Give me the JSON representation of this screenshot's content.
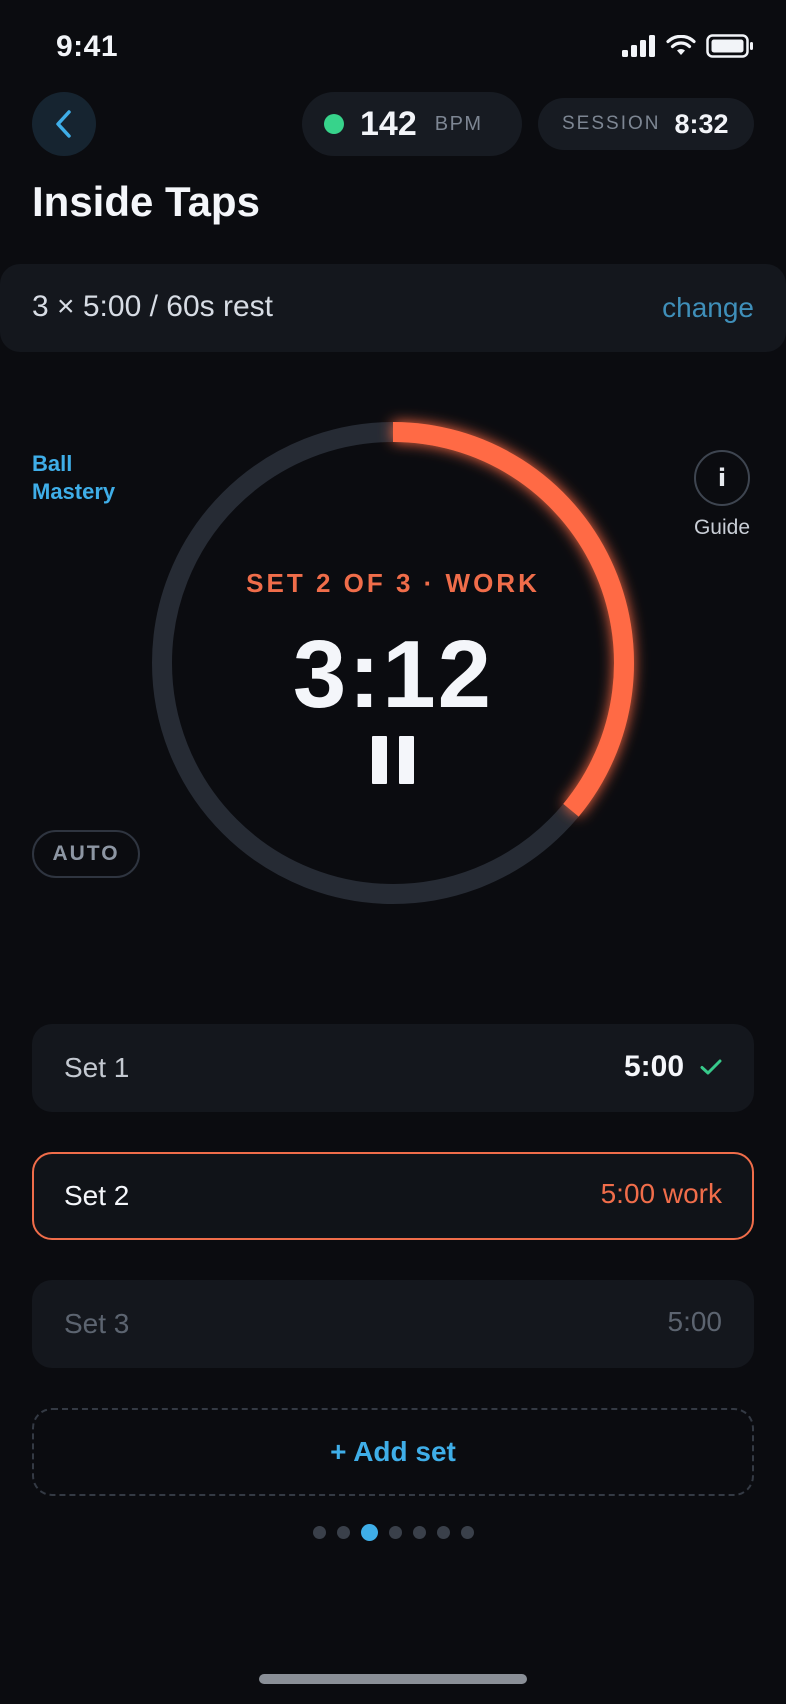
{
  "status_bar": {
    "time": "9:41"
  },
  "header": {
    "bpm_value": "142",
    "bpm_unit": "BPM",
    "session_label": "SESSION",
    "session_time": "8:32",
    "title": "Inside Taps"
  },
  "config": {
    "text": "3 × 5:00 / 60s rest",
    "change_label": "change"
  },
  "timer": {
    "category_line1": "Ball",
    "category_line2": "Mastery",
    "guide_icon": "i",
    "guide_label": "Guide",
    "auto_label": "AUTO",
    "phase_label": "SET 2 OF 3 · WORK",
    "remaining": "3:12",
    "progress_fraction": 0.36,
    "ring_color": "#ff6b45",
    "track_color": "#262b34"
  },
  "sets": [
    {
      "label": "Set 1",
      "duration": "5:00",
      "status": "done",
      "check_icon": "✓"
    },
    {
      "label": "Set 2",
      "duration": "5:00 work",
      "status": "active"
    },
    {
      "label": "Set 3",
      "duration": "5:00",
      "status": "upcoming"
    }
  ],
  "add_set_label": "+ Add set",
  "pagination": {
    "total": 7,
    "active_index": 2
  },
  "colors": {
    "accent_orange": "#f06d4a",
    "accent_blue": "#3faee8",
    "bpm_dot": "#37d38b",
    "check_green": "#37c98a"
  }
}
